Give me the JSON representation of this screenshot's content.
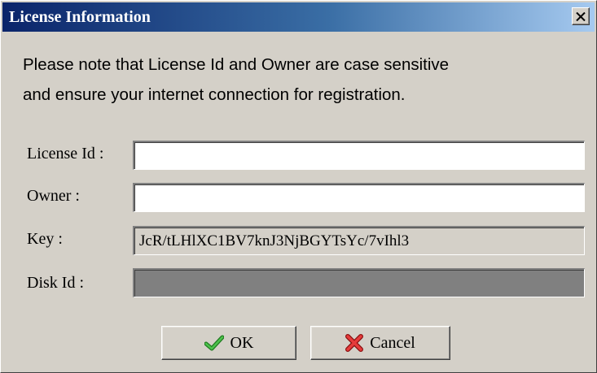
{
  "window": {
    "title": "License Information",
    "close_icon": "close-icon"
  },
  "notice": {
    "line1": "Please note that License Id and Owner are case sensitive",
    "line2": "and ensure your internet connection for registration."
  },
  "fields": {
    "license_id": {
      "label": "License Id :",
      "value": ""
    },
    "owner": {
      "label": "Owner :",
      "value": ""
    },
    "key": {
      "label": "Key :",
      "value": "JcR/tLHlXC1BV7knJ3NjBGYTsYc/7vIhl3"
    },
    "disk_id": {
      "label": "Disk Id :",
      "value": ""
    }
  },
  "buttons": {
    "ok": {
      "label": "OK",
      "icon": "checkmark-icon",
      "icon_color": "#2e9a2e"
    },
    "cancel": {
      "label": "Cancel",
      "icon": "red-x-icon",
      "icon_color": "#d42a2a"
    }
  },
  "colors": {
    "title_gradient_start": "#0a246a",
    "title_gradient_end": "#a6caf0",
    "dialog_background": "#d4d0c8",
    "disabled_field": "#808080"
  }
}
